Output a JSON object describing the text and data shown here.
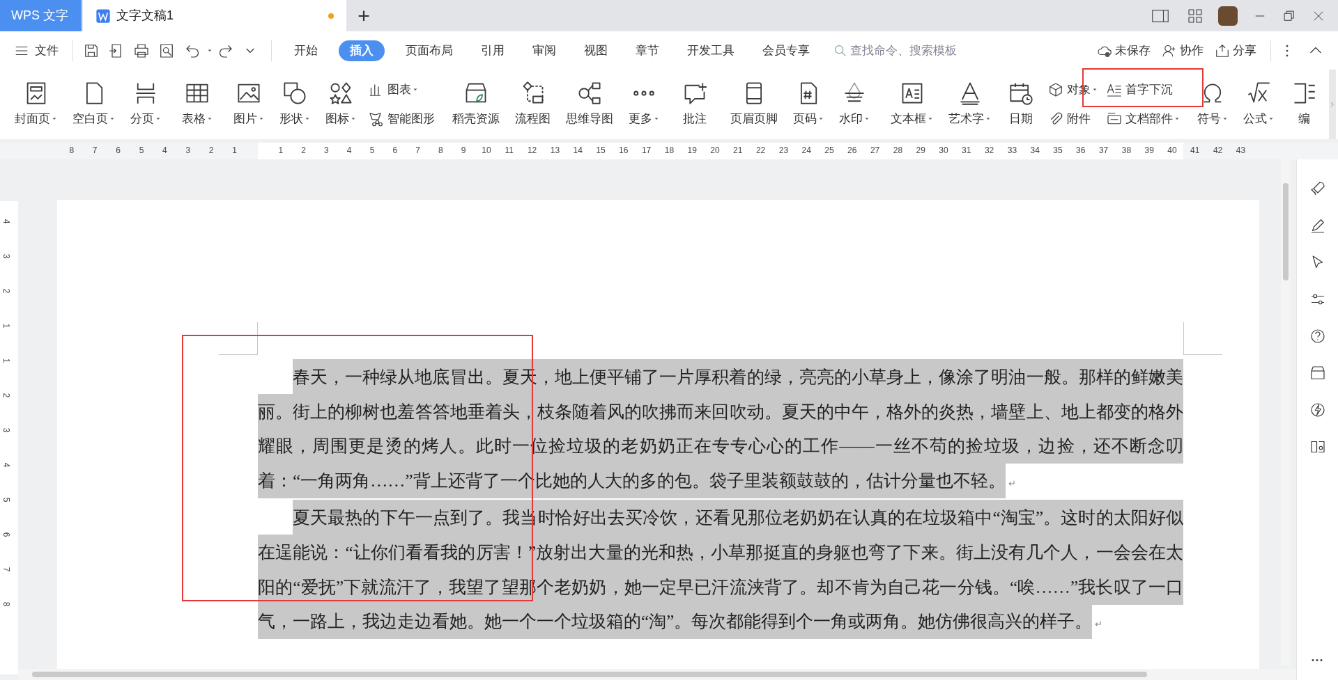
{
  "title_bar": {
    "app_tab": "WPS 文字",
    "document_tab": {
      "title": "文字文稿1",
      "modified": true
    },
    "new_tab": "+"
  },
  "toolbar": {
    "file_menu": "文件",
    "tabs": [
      {
        "label": "开始",
        "selected": false
      },
      {
        "label": "插入",
        "selected": true
      },
      {
        "label": "页面布局",
        "selected": false
      },
      {
        "label": "引用",
        "selected": false
      },
      {
        "label": "审阅",
        "selected": false
      },
      {
        "label": "视图",
        "selected": false
      },
      {
        "label": "章节",
        "selected": false
      },
      {
        "label": "开发工具",
        "selected": false
      },
      {
        "label": "会员专享",
        "selected": false
      }
    ],
    "search": {
      "placeholder": "查找命令、搜索模板"
    },
    "actions": [
      "未保存",
      "协作",
      "分享"
    ]
  },
  "ribbon": {
    "groups": [
      {
        "items": [
          {
            "kind": "large",
            "label": "封面页",
            "dropdown": true
          },
          {
            "kind": "large",
            "label": "空白页",
            "dropdown": true
          },
          {
            "kind": "large",
            "label": "分页",
            "dropdown": true
          }
        ]
      },
      {
        "items": [
          {
            "kind": "large",
            "label": "表格",
            "dropdown": true
          }
        ]
      },
      {
        "items": [
          {
            "kind": "large",
            "label": "图片",
            "dropdown": true
          },
          {
            "kind": "large",
            "label": "形状",
            "dropdown": true
          },
          {
            "kind": "large",
            "label": "图标",
            "dropdown": true
          },
          {
            "kind": "stack",
            "items": [
              {
                "label": "图表",
                "dropdown": true
              },
              {
                "label": "智能图形",
                "dropdown": false
              }
            ]
          }
        ]
      },
      {
        "items": [
          {
            "kind": "large",
            "label": "稻壳资源",
            "dropdown": false
          },
          {
            "kind": "large",
            "label": "流程图",
            "dropdown": false
          },
          {
            "kind": "large",
            "label": "思维导图",
            "dropdown": false
          },
          {
            "kind": "large",
            "label": "更多",
            "dropdown": true
          }
        ]
      },
      {
        "items": [
          {
            "kind": "large",
            "label": "批注",
            "dropdown": false
          }
        ]
      },
      {
        "items": [
          {
            "kind": "large",
            "label": "页眉页脚",
            "dropdown": false
          },
          {
            "kind": "large",
            "label": "页码",
            "dropdown": true
          },
          {
            "kind": "large",
            "label": "水印",
            "dropdown": true
          }
        ]
      },
      {
        "items": [
          {
            "kind": "large",
            "label": "文本框",
            "dropdown": true
          },
          {
            "kind": "large",
            "label": "艺术字",
            "dropdown": true
          },
          {
            "kind": "large",
            "label": "日期",
            "dropdown": false
          },
          {
            "kind": "stack",
            "items": [
              {
                "label": "对象",
                "dropdown": true
              },
              {
                "label": "附件",
                "dropdown": false
              }
            ]
          },
          {
            "kind": "stack",
            "items": [
              {
                "label": "首字下沉",
                "dropdown": false
              },
              {
                "label": "文档部件",
                "dropdown": true
              }
            ]
          }
        ]
      },
      {
        "items": [
          {
            "kind": "large",
            "label": "符号",
            "dropdown": true
          },
          {
            "kind": "large",
            "label": "公式",
            "dropdown": true
          },
          {
            "kind": "large",
            "label": "编",
            "dropdown": false
          }
        ]
      }
    ]
  },
  "ruler": {
    "left_numbers": [
      "8",
      "7",
      "6",
      "5",
      "4",
      "3",
      "2",
      "1"
    ],
    "right_numbers": [
      "1",
      "2",
      "3",
      "4",
      "5",
      "6",
      "7",
      "8",
      "9",
      "10",
      "11",
      "12",
      "13",
      "14",
      "15",
      "16",
      "17",
      "18",
      "19",
      "20",
      "21",
      "22",
      "23",
      "24",
      "25",
      "26",
      "27",
      "28",
      "29",
      "30",
      "31",
      "32",
      "33",
      "34",
      "35",
      "36",
      "37",
      "38",
      "39",
      "40",
      "41",
      "42",
      "43"
    ]
  },
  "vertical_ruler": {
    "numbers": [
      "4",
      "3",
      "2",
      "1",
      "1",
      "2",
      "3",
      "4",
      "5",
      "6",
      "7",
      "8"
    ]
  },
  "document": {
    "paragraphs": [
      {
        "text": "春天，一种绿从地底冒出。夏天，地上便平铺了一片厚积着的绿，亮亮的小草身上，像涂了明油一般。那样的鲜嫩美丽。街上的柳树也羞答答地垂着头，枝条随着风的吹拂而来回吹动。夏天的中午，格外的炎热，墙壁上、地上都变的格外耀眼，周围更是烫的烤人。此时一位捡垃圾的老奶奶正在专专心心的工作——一丝不苟的捡垃圾，边捡，还不断念叨着：“一角两角……”背上还背了一个比她的人大的多的包。袋子里装额鼓鼓的，估计分量也不轻。",
        "selected": true,
        "end_mark": "↵"
      },
      {
        "text": "夏天最热的下午一点到了。我当时恰好出去买冷饮，还看见那位老奶奶在认真的在垃圾箱中“淘宝”。这时的太阳好似在逞能说：“让你们看看我的厉害！”放射出大量的光和热，小草那挺直的身躯也弯了下来。街上没有几个人，一会会在太阳的“爱抚”下就流汗了，我望了望那个老奶奶，她一定早已汗流浃背了。却不肯为自己花一分钱。“唉……”我长叹了一口气，一路上，我边走边看她。她一个一个垃圾箱的“淘”。每次都能得到个一角或两角。她仿佛很高兴的样子。",
        "selected": true,
        "end_mark": "↵"
      }
    ]
  },
  "side_panel": {
    "more": "···"
  }
}
